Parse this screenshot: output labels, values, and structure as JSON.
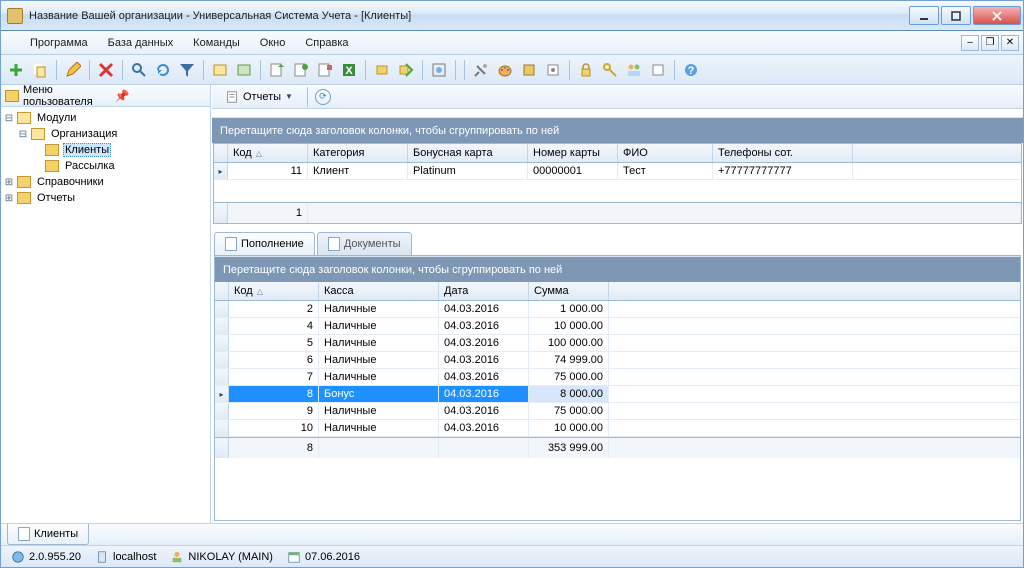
{
  "window": {
    "title": "Название Вашей организации - Универсальная Система Учета - [Клиенты]"
  },
  "menu": {
    "program": "Программа",
    "database": "База данных",
    "commands": "Команды",
    "window": "Окно",
    "help": "Справка"
  },
  "leftPanel": {
    "header": "Меню пользователя",
    "nodes": {
      "modules": "Модули",
      "organization": "Организация",
      "clients": "Клиенты",
      "mailing": "Рассылка",
      "directories": "Справочники",
      "reports": "Отчеты"
    }
  },
  "reportsBar": {
    "label": "Отчеты"
  },
  "groupHint": "Перетащите сюда заголовок колонки, чтобы сгруппировать по ней",
  "topGrid": {
    "headers": {
      "code": "Код",
      "category": "Категория",
      "bonusCard": "Бонусная карта",
      "cardNumber": "Номер карты",
      "fio": "ФИО",
      "phone": "Телефоны сот."
    },
    "row": {
      "code": "11",
      "category": "Клиент",
      "bonusCard": "Platinum",
      "cardNumber": "00000001",
      "fio": "Тест",
      "phone": "+77777777777"
    },
    "footerCount": "1"
  },
  "tabs": {
    "topup": "Пополнение",
    "documents": "Документы"
  },
  "detailGrid": {
    "headers": {
      "code": "Код",
      "kassa": "Касса",
      "date": "Дата",
      "sum": "Сумма"
    },
    "rows": [
      {
        "code": "2",
        "kassa": "Наличные",
        "date": "04.03.2016",
        "sum": "1 000.00"
      },
      {
        "code": "4",
        "kassa": "Наличные",
        "date": "04.03.2016",
        "sum": "10 000.00"
      },
      {
        "code": "5",
        "kassa": "Наличные",
        "date": "04.03.2016",
        "sum": "100 000.00"
      },
      {
        "code": "6",
        "kassa": "Наличные",
        "date": "04.03.2016",
        "sum": "74 999.00"
      },
      {
        "code": "7",
        "kassa": "Наличные",
        "date": "04.03.2016",
        "sum": "75 000.00"
      },
      {
        "code": "8",
        "kassa": "Бонус",
        "date": "04.03.2016",
        "sum": "8 000.00"
      },
      {
        "code": "9",
        "kassa": "Наличные",
        "date": "04.03.2016",
        "sum": "75 000.00"
      },
      {
        "code": "10",
        "kassa": "Наличные",
        "date": "04.03.2016",
        "sum": "10 000.00"
      }
    ],
    "selectedIndex": 5,
    "footer": {
      "count": "8",
      "total": "353 999.00"
    }
  },
  "bottomTab": "Клиенты",
  "status": {
    "version": "2.0.955.20",
    "host": "localhost",
    "user": "NIKOLAY (MAIN)",
    "date": "07.06.2016"
  }
}
